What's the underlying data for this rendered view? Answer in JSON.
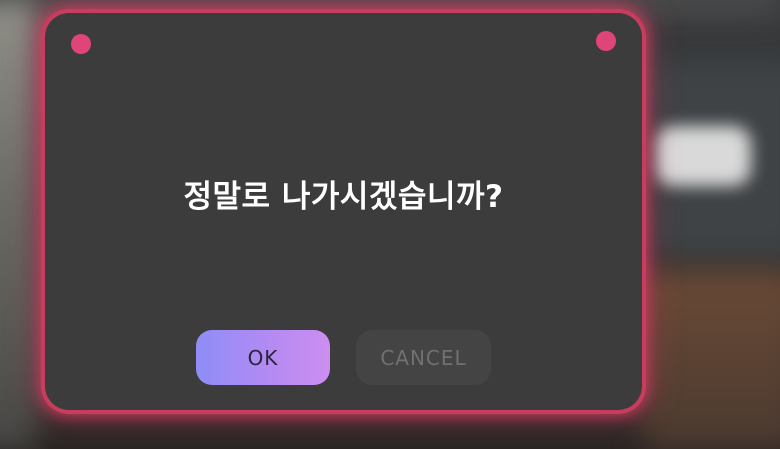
{
  "dialog": {
    "message": "정말로 나가시겠습니까?",
    "ok_label": "OK",
    "cancel_label": "CANCEL"
  },
  "colors": {
    "dialog_background": "#3c3c3c",
    "dialog_border_glow": "#e23e68",
    "corner_dots": "#e0457a",
    "ok_gradient_start": "#8f8df7",
    "ok_gradient_end": "#cd8ef0",
    "cancel_background": "#444444",
    "cancel_text": "#717171",
    "message_text": "#ffffff"
  }
}
